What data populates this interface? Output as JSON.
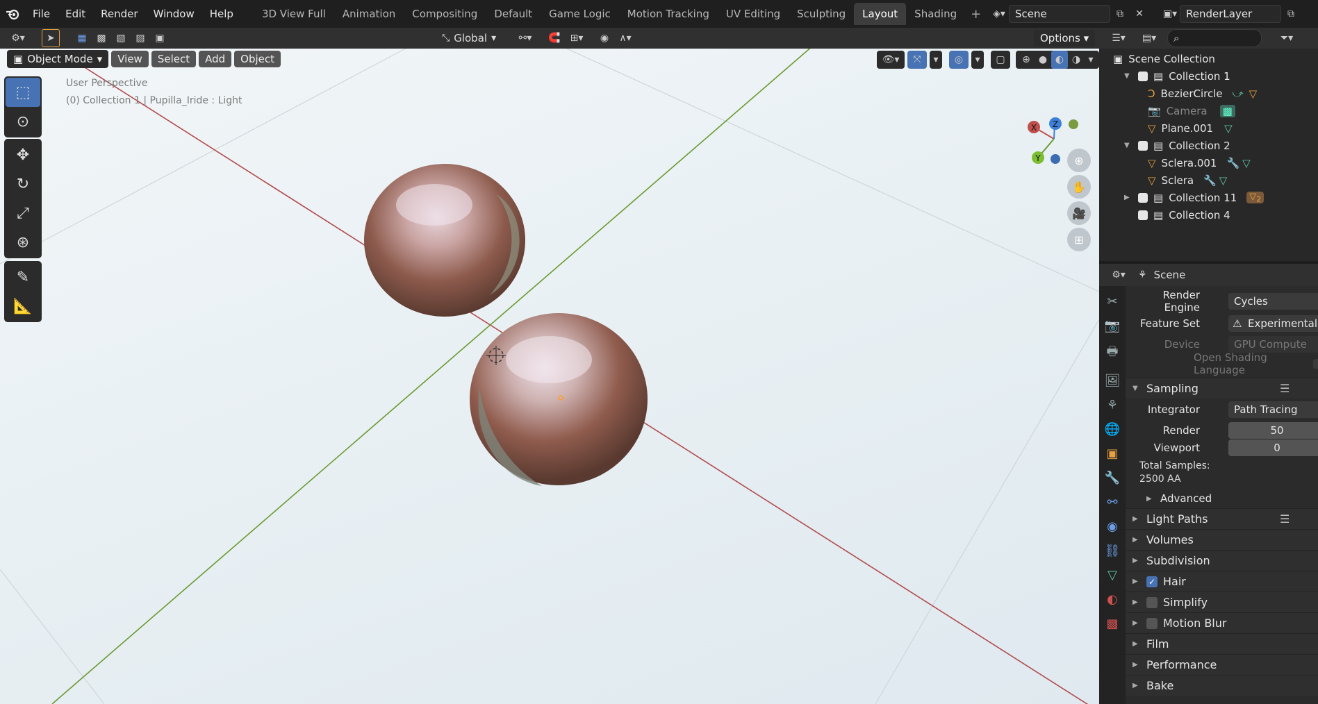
{
  "menu": [
    "File",
    "Edit",
    "Render",
    "Window",
    "Help"
  ],
  "workspaces": [
    "3D View Full",
    "Animation",
    "Compositing",
    "Default",
    "Game Logic",
    "Motion Tracking",
    "UV Editing",
    "Sculpting",
    "Layout",
    "Shading"
  ],
  "active_workspace": "Layout",
  "scene_name": "Scene",
  "view_layer": "RenderLayer",
  "viewport": {
    "orientation": "Global",
    "options_label": "Options",
    "mode": "Object Mode",
    "header_menus": [
      "View",
      "Select",
      "Add",
      "Object"
    ],
    "perspective_label": "User Perspective",
    "context_label": "(0) Collection 1 | Pupilla_Iride : Light",
    "gizmo_axes": [
      "X",
      "Y",
      "Z"
    ]
  },
  "outliner": {
    "root": "Scene Collection",
    "rows": [
      {
        "name": "Collection 1",
        "type": "collection"
      },
      {
        "name": "BezierCircle",
        "type": "curve"
      },
      {
        "name": "Camera",
        "type": "camera"
      },
      {
        "name": "Plane.001",
        "type": "mesh"
      },
      {
        "name": "Collection 2",
        "type": "collection"
      },
      {
        "name": "Sclera.001",
        "type": "mesh"
      },
      {
        "name": "Sclera",
        "type": "mesh"
      },
      {
        "name": "Collection 11",
        "type": "collection",
        "badge": "2"
      },
      {
        "name": "Collection 4",
        "type": "collection"
      }
    ]
  },
  "properties": {
    "context": "Scene",
    "render_engine_label": "Render Engine",
    "render_engine": "Cycles",
    "feature_set_label": "Feature Set",
    "feature_set": "Experimental",
    "device_label": "Device",
    "device": "GPU Compute",
    "osl_label": "Open Shading Language",
    "sampling_label": "Sampling",
    "integrator_label": "Integrator",
    "integrator": "Path Tracing",
    "render_label": "Render",
    "render_samples": "50",
    "viewport_label": "Viewport",
    "viewport_samples": "0",
    "total_samples_label": "Total Samples:",
    "total_samples_value": "2500 AA",
    "advanced_label": "Advanced",
    "panels": [
      "Light Paths",
      "Volumes",
      "Subdivision",
      "Hair",
      "Simplify",
      "Motion Blur",
      "Film",
      "Performance",
      "Bake"
    ]
  },
  "colors": {
    "accent": "#4772b3",
    "x_axis": "#c0504d",
    "y_axis": "#6a9a2f",
    "z_axis": "#3e7fd8"
  }
}
